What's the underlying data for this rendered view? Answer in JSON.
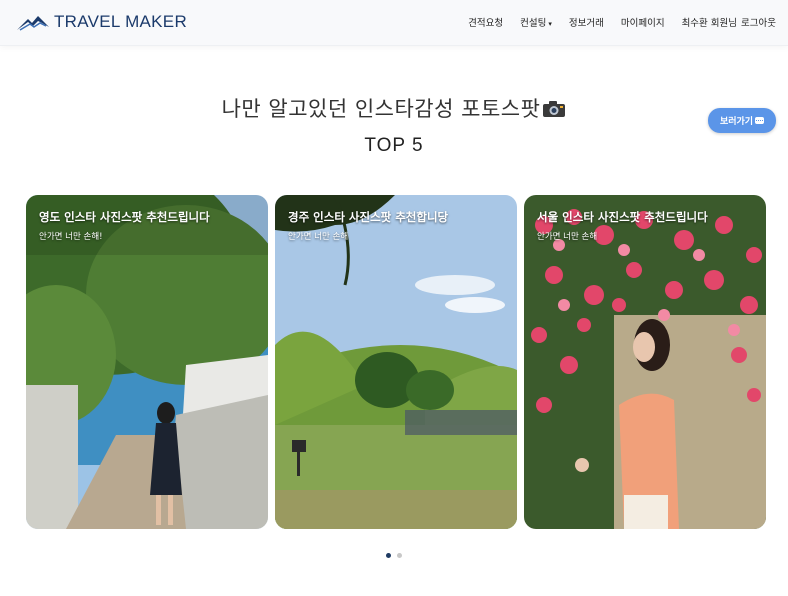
{
  "brand": {
    "name": "TRAVEL MAKER"
  },
  "nav": {
    "items": [
      "견적요청",
      "컨설팅",
      "정보거래",
      "마이페이지",
      "최수환 회원님",
      "로그아웃"
    ],
    "consulting_caret": "▾"
  },
  "hero": {
    "headline": "나만 알고있던 인스타감성 포토스팟",
    "subheadline": "TOP 5",
    "see_button": "보러가기"
  },
  "cards": [
    {
      "title": "영도 인스타 사진스팟 추천드립니다",
      "subtitle": "안가면 너만 손해!"
    },
    {
      "title": "경주 인스타 사진스팟 추천합니당",
      "subtitle": "안가면 너만 손해"
    },
    {
      "title": "서울 인스타 사진스팟 추천드립니다",
      "subtitle": "안가면 너만 손해"
    }
  ],
  "carousel": {
    "page_count": 2,
    "active_index": 0
  },
  "colors": {
    "brand": "#1b3a6b",
    "button": "#5b95e8",
    "dot_active": "#1f3b63"
  }
}
